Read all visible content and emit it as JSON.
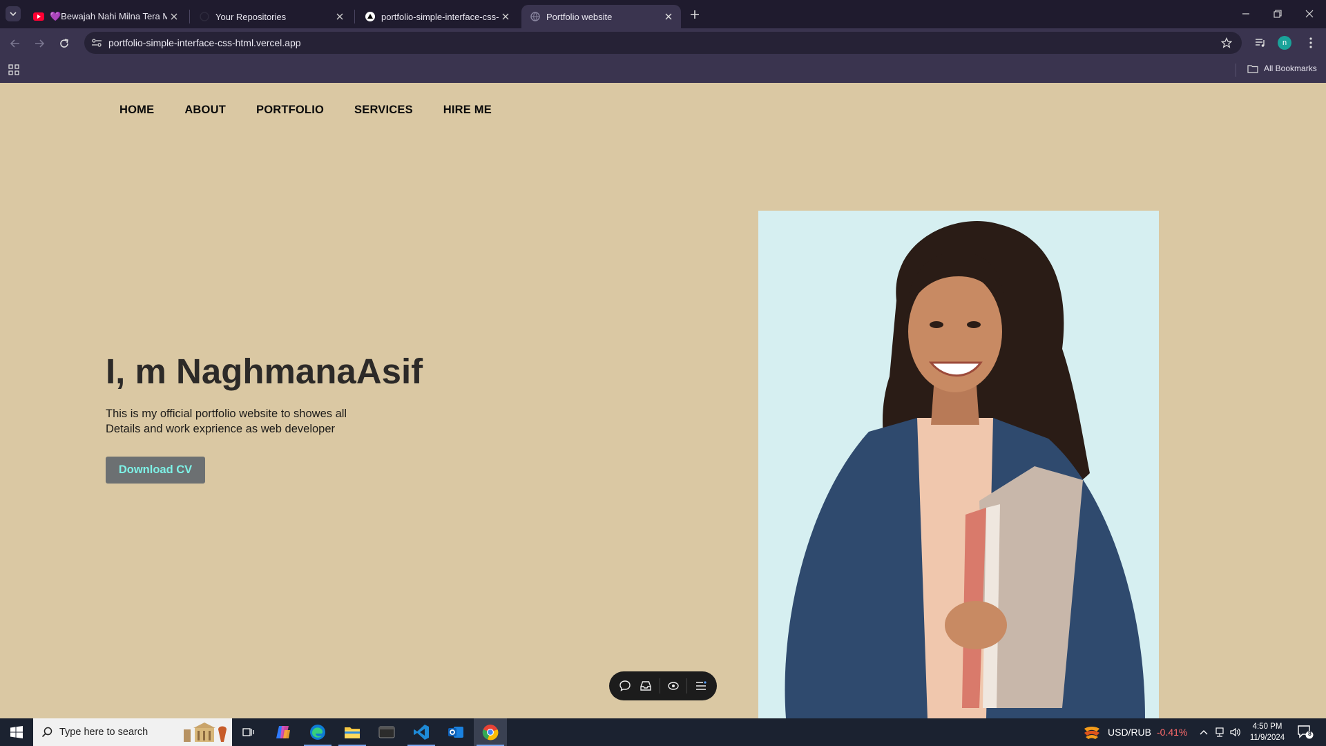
{
  "browser": {
    "tabs": [
      {
        "title": "💜Bewajah Nahi Milna Tera Me",
        "favicon": "youtube-icon",
        "active": false
      },
      {
        "title": "Your Repositories",
        "favicon": "github-icon",
        "active": false
      },
      {
        "title": "portfolio-simple-interface-css-h",
        "favicon": "vercel-icon",
        "active": false
      },
      {
        "title": "Portfolio website",
        "favicon": "globe-icon",
        "active": true
      }
    ],
    "url": "portfolio-simple-interface-css-html.vercel.app",
    "profile_initial": "n",
    "bookmarks_label": "All Bookmarks"
  },
  "page": {
    "nav": [
      "HOME",
      "ABOUT",
      "PORTFOLIO",
      "SERVICES",
      "HIRE ME"
    ],
    "hero_title": "I, m NaghmanaAsif",
    "hero_desc_line1": "This is my official portfolio website to showes all",
    "hero_desc_line2": "Details and work exprience as web developer",
    "cv_button": "Download CV",
    "colors": {
      "background": "#dac8a3",
      "button_bg": "#6c7072",
      "button_text": "#7ef2e7",
      "photo_bg": "#d6eff1"
    }
  },
  "taskbar": {
    "search_placeholder": "Type here to search",
    "ticker_symbol": "USD/RUB",
    "ticker_change": "-0.41%",
    "time": "4:50 PM",
    "date": "11/9/2024",
    "notification_count": "8"
  }
}
